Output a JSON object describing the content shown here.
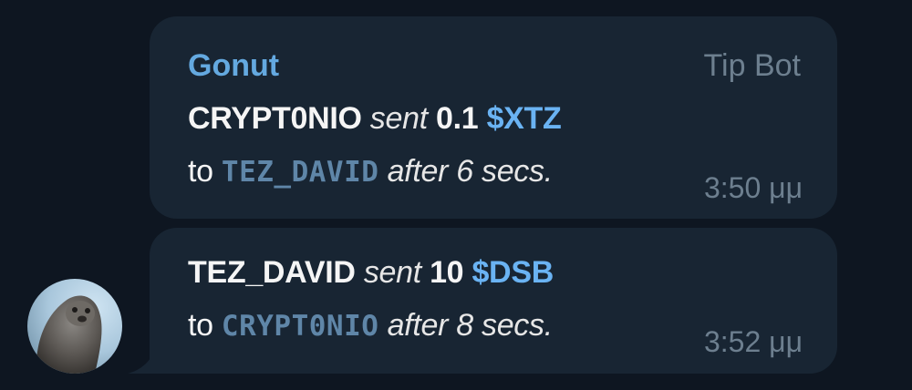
{
  "messages": [
    {
      "sender": "Gonut",
      "via": "Tip Bot",
      "line1": {
        "user": "CRYPT0NIO",
        "verb": "sent",
        "amount": "0.1",
        "token": "$XTZ"
      },
      "line2": {
        "to": "to",
        "recipient": "TEZ_DAVID",
        "after": "after 6 secs."
      },
      "time": "3:50 μμ"
    },
    {
      "line1": {
        "user": "TEZ_DAVID",
        "verb": "sent",
        "amount": "10",
        "token": "$DSB"
      },
      "line2": {
        "to": "to",
        "recipient": "CRYPT0NIO",
        "after": "after 8 secs."
      },
      "time": "3:52 μμ"
    }
  ],
  "colors": {
    "background": "#0e1621",
    "bubble": "#182533",
    "sender": "#64a9e0",
    "cashtag": "#6ab3f3",
    "mention": "#5f86a8",
    "meta": "#6d7f8f"
  },
  "avatar": {
    "icon": "seal-avatar-icon"
  }
}
